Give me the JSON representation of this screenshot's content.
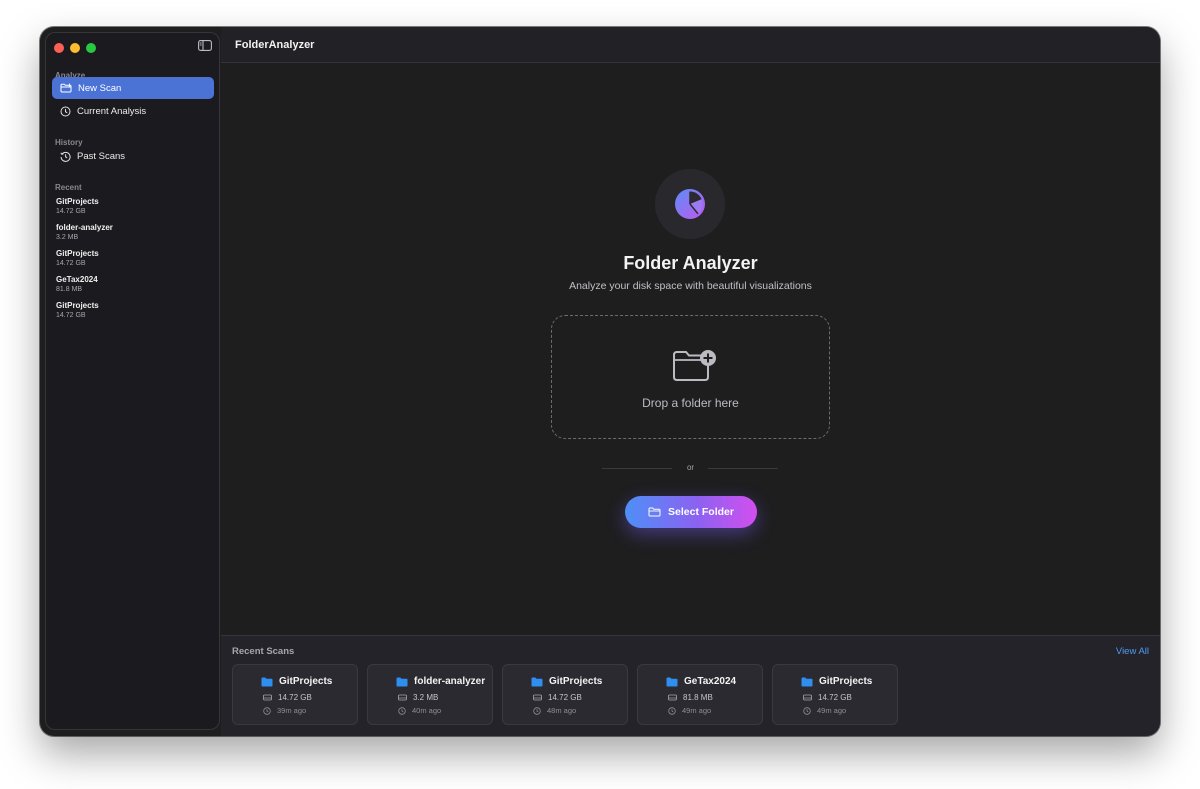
{
  "app": {
    "title": "FolderAnalyzer"
  },
  "sidebar": {
    "sections": {
      "analyze": "Analyze",
      "history": "History",
      "recent": "Recent"
    },
    "analyze_items": [
      {
        "label": "New Scan",
        "icon": "folder-plus-icon",
        "active": true
      },
      {
        "label": "Current Analysis",
        "icon": "clock-icon",
        "active": false
      }
    ],
    "history_items": [
      {
        "label": "Past Scans",
        "icon": "history-icon",
        "active": false
      }
    ],
    "recent_items": [
      {
        "name": "GitProjects",
        "size": "14.72 GB"
      },
      {
        "name": "folder-analyzer",
        "size": "3.2 MB"
      },
      {
        "name": "GitProjects",
        "size": "14.72 GB"
      },
      {
        "name": "GeTax2024",
        "size": "81.8 MB"
      },
      {
        "name": "GitProjects",
        "size": "14.72 GB"
      }
    ]
  },
  "hero": {
    "title": "Folder Analyzer",
    "subtitle": "Analyze your disk space with beautiful visualizations",
    "dropzone_label": "Drop a folder here",
    "divider_text": "or",
    "select_button": "Select Folder"
  },
  "recent_scans": {
    "heading": "Recent Scans",
    "view_all": "View All",
    "cards": [
      {
        "name": "GitProjects",
        "size": "14.72 GB",
        "time": "39m ago"
      },
      {
        "name": "folder-analyzer",
        "size": "3.2 MB",
        "time": "40m ago"
      },
      {
        "name": "GitProjects",
        "size": "14.72 GB",
        "time": "48m ago"
      },
      {
        "name": "GeTax2024",
        "size": "81.8 MB",
        "time": "49m ago"
      },
      {
        "name": "GitProjects",
        "size": "14.72 GB",
        "time": "49m ago"
      }
    ]
  },
  "colors": {
    "accent": "#4b73d6",
    "link": "#4f9bf0",
    "folder": "#2f8ff0",
    "gradient_start": "#4e8ff7",
    "gradient_end": "#d24fef"
  }
}
